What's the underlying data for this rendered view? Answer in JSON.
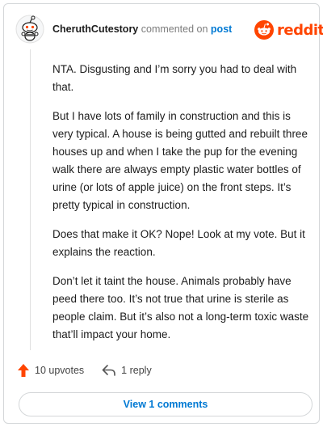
{
  "comment": {
    "username": "CheruthCutestory",
    "action_text": "commented on",
    "post_link": "post",
    "brand": "reddit",
    "paragraphs": [
      "NTA. Disgusting and I’m sorry you had to deal with that.",
      "But I have lots of family in construction and this is very typical. A house is being gutted and rebuilt three houses up and when I take the pup for the evening walk there are always empty plastic water bottles of urine (or lots of apple juice) on the front steps. It’s pretty typical in construction.",
      "Does that make it OK? Nope! Look at my vote. But it explains the reaction.",
      "Don’t let it taint the house. Animals probably have peed there too. It’s not true that urine is sterile as people claim. But it’s also not a long-term toxic waste that’ll impact your home."
    ],
    "upvotes_label": "10 upvotes",
    "replies_label": "1 reply",
    "view_comments_label": "View 1 comments"
  },
  "colors": {
    "brand_orange": "#ff4500",
    "link_blue": "#0079d3",
    "upvote_orange": "#ff4500"
  },
  "icons": {
    "avatar": "snoo-avatar-icon",
    "logo": "reddit-logo-icon",
    "upvote": "upvote-arrow-icon",
    "reply": "reply-arrow-icon"
  }
}
